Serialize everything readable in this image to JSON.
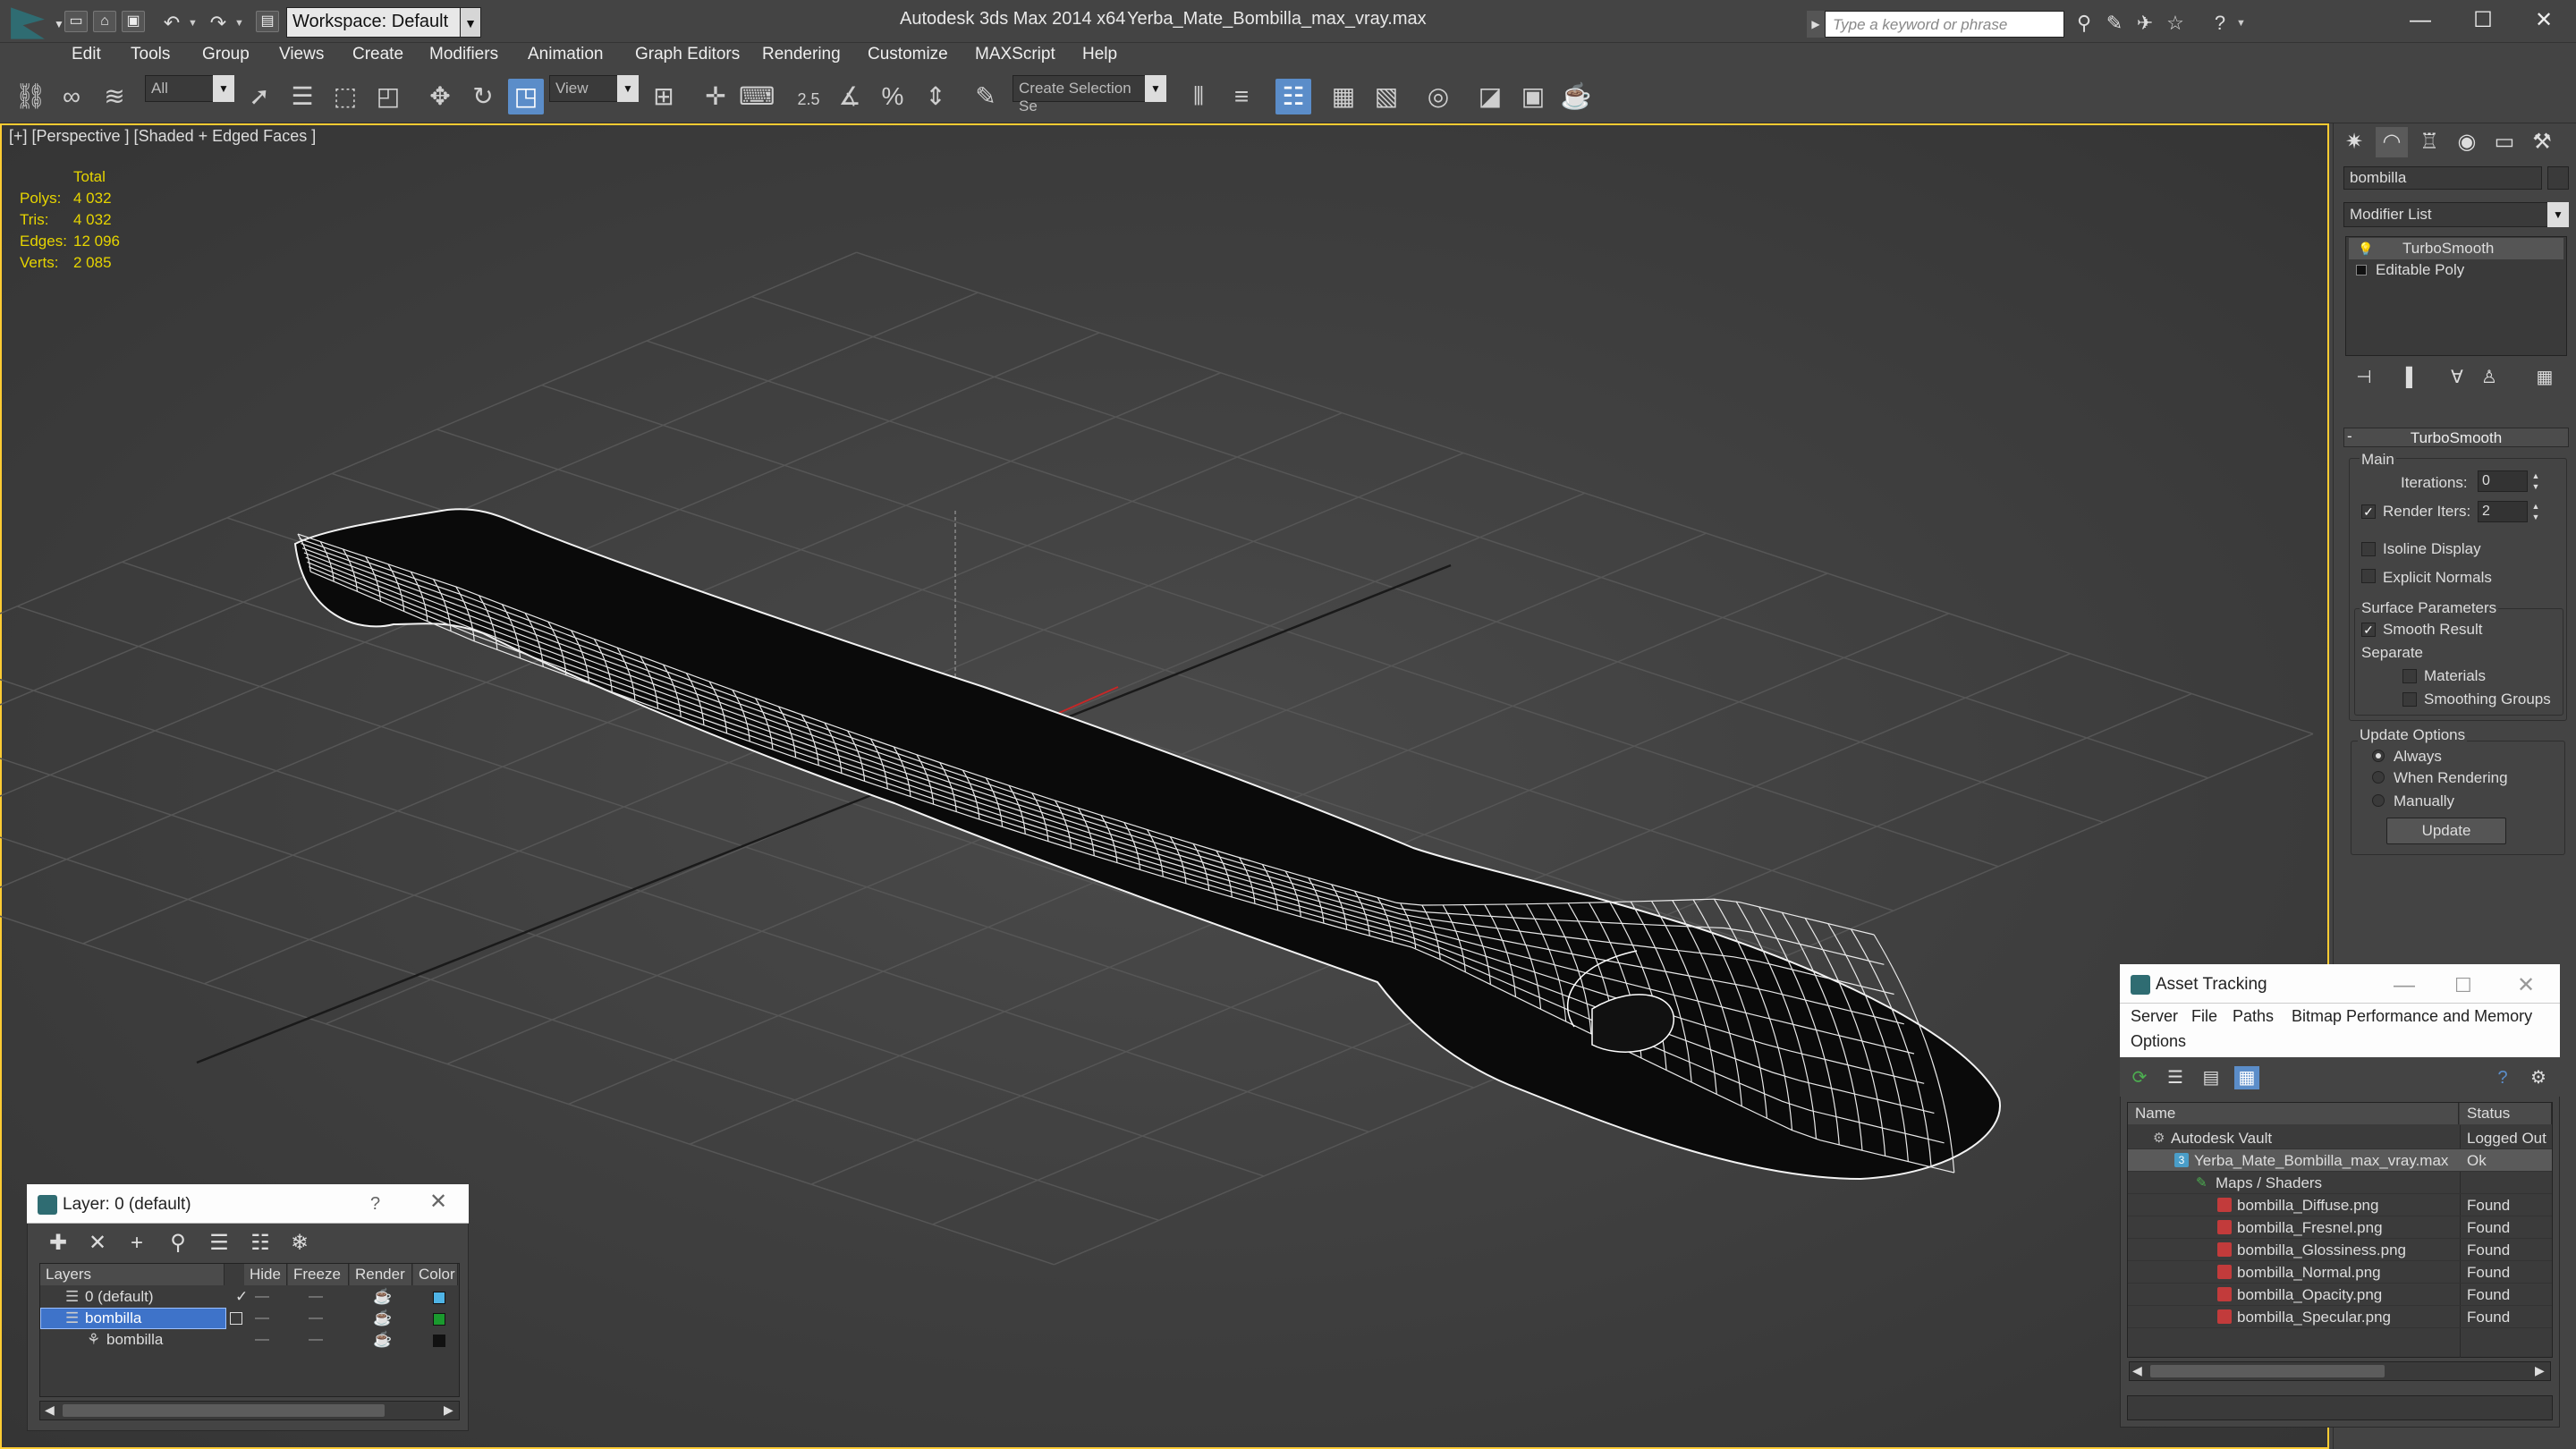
{
  "titlebar": {
    "workspace": "Workspace: Default",
    "app_title": "Autodesk 3ds Max  2014 x64",
    "file_title": "Yerba_Mate_Bombilla_max_vray.max",
    "search_placeholder": "Type a keyword or phrase"
  },
  "menu": [
    "Edit",
    "Tools",
    "Group",
    "Views",
    "Create",
    "Modifiers",
    "Animation",
    "Graph Editors",
    "Rendering",
    "Customize",
    "MAXScript",
    "Help"
  ],
  "toolbar": {
    "selection_filter": "All",
    "ref_coord": "View",
    "named_selection_placeholder": "Create Selection Se",
    "snap_label": "2.5"
  },
  "viewport": {
    "label": "[+] [Perspective ] [Shaded + Edged Faces ]",
    "stats_header": "Total",
    "stats": [
      {
        "label": "Polys:",
        "value": "4 032"
      },
      {
        "label": "Tris:",
        "value": "4 032"
      },
      {
        "label": "Edges:",
        "value": "12 096"
      },
      {
        "label": "Verts:",
        "value": "2 085"
      }
    ]
  },
  "command_panel": {
    "object_name": "bombilla",
    "modifier_list": "Modifier List",
    "stack": [
      "TurboSmooth",
      "Editable Poly"
    ],
    "turbosmooth": {
      "title": "TurboSmooth",
      "main": "Main",
      "iterations_label": "Iterations:",
      "iterations": "0",
      "render_iters_label": "Render Iters:",
      "render_iters": "2",
      "isoline": "Isoline Display",
      "explicit_normals": "Explicit Normals",
      "surface_params": "Surface Parameters",
      "smooth_result": "Smooth Result",
      "separate": "Separate",
      "materials": "Materials",
      "smoothing_groups": "Smoothing Groups",
      "update_options": "Update Options",
      "always": "Always",
      "when_rendering": "When Rendering",
      "manually": "Manually",
      "update": "Update"
    }
  },
  "layer_dialog": {
    "title": "Layer: 0 (default)",
    "question": "?",
    "columns": [
      "Layers",
      "Hide",
      "Freeze",
      "Render",
      "Color"
    ],
    "rows": [
      {
        "name": "0 (default)",
        "color": "#4fb4e6"
      },
      {
        "name": "bombilla",
        "color": "#1a9a2e"
      },
      {
        "name": "bombilla",
        "color": "#111111"
      }
    ]
  },
  "asset_tracking": {
    "title": "Asset Tracking",
    "menu": [
      "Server",
      "File",
      "Paths",
      "Bitmap Performance and Memory",
      "Options"
    ],
    "columns": [
      "Name",
      "Status"
    ],
    "rows": [
      {
        "name": "Autodesk Vault",
        "status": "Logged Out"
      },
      {
        "name": "Yerba_Mate_Bombilla_max_vray.max",
        "status": "Ok"
      },
      {
        "name": "Maps / Shaders",
        "status": ""
      },
      {
        "name": "bombilla_Diffuse.png",
        "status": "Found"
      },
      {
        "name": "bombilla_Fresnel.png",
        "status": "Found"
      },
      {
        "name": "bombilla_Glossiness.png",
        "status": "Found"
      },
      {
        "name": "bombilla_Normal.png",
        "status": "Found"
      },
      {
        "name": "bombilla_Opacity.png",
        "status": "Found"
      },
      {
        "name": "bombilla_Specular.png",
        "status": "Found"
      }
    ]
  },
  "colors": {
    "viewport_border": "#ffcc33",
    "selection_blue": "#3e73c9",
    "stats_yellow": "#e6d400"
  }
}
